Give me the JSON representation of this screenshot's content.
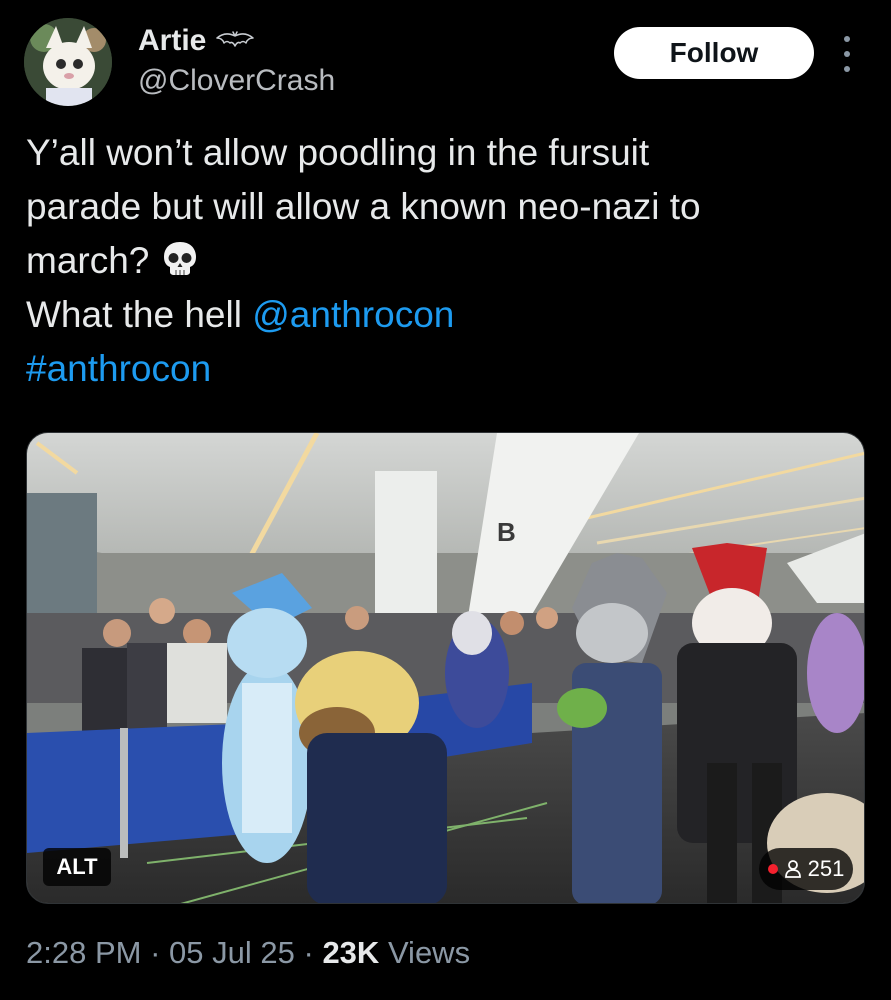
{
  "author": {
    "name": "Artie",
    "handle": "@CloverCrash",
    "follow_label": "Follow"
  },
  "tweet": {
    "line1": "Y’all won’t allow poodling in the fursuit",
    "line2": "parade but will allow a known neo-nazi to",
    "line3": "march?",
    "line4_prefix": "What the hell",
    "mention": "@anthrocon",
    "hashtag": "#anthrocon"
  },
  "media": {
    "alt_label": "ALT",
    "viewer_count": "251",
    "sign_letter": "B"
  },
  "meta": {
    "time": "2:28 PM",
    "separator": "·",
    "date": "05 Jul 25",
    "views_count": "23K",
    "views_label": "Views"
  },
  "colors": {
    "background": "#000000",
    "text": "#e7e9ea",
    "secondary": "#8b98a5",
    "link": "#1d9bf0",
    "live": "#f4212e"
  },
  "icons": [
    "bat-icon",
    "more-icon",
    "skull-icon",
    "person-icon",
    "live-dot-icon"
  ]
}
